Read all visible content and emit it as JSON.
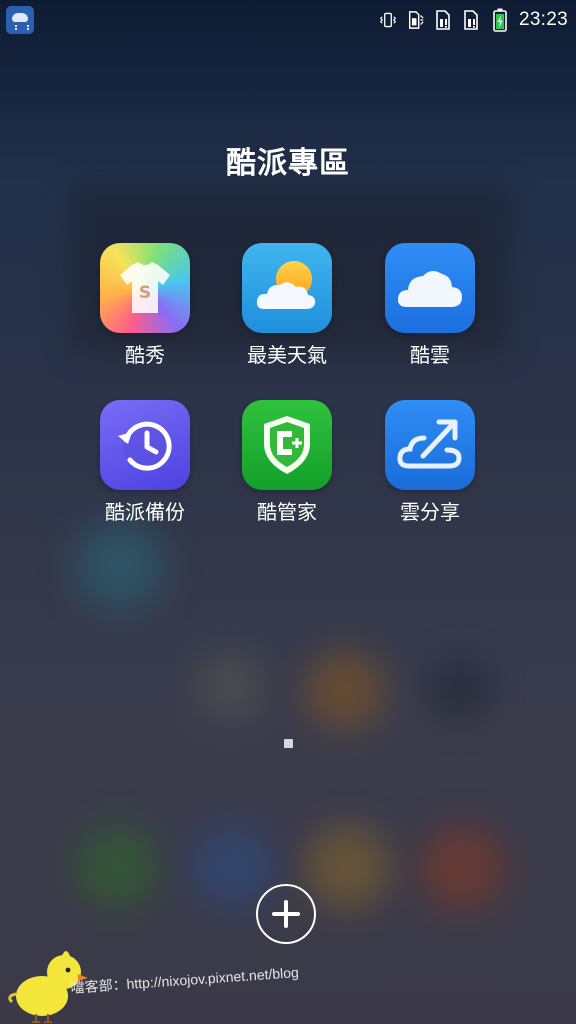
{
  "status_bar": {
    "time": "23:23",
    "icons": [
      "weather-notification-icon",
      "vibrate-icon",
      "sim1-volte-icon",
      "sim-card-icon",
      "sim-card-icon",
      "battery-charging-icon"
    ]
  },
  "folder": {
    "title": "酷派專區",
    "apps": [
      {
        "label": "酷秀",
        "icon": "tshirt-icon"
      },
      {
        "label": "最美天氣",
        "icon": "sun-cloud-icon"
      },
      {
        "label": "酷雲",
        "icon": "cloud-icon"
      },
      {
        "label": "酷派備份",
        "icon": "history-clock-icon"
      },
      {
        "label": "酷管家",
        "icon": "shield-plus-icon"
      },
      {
        "label": "雲分享",
        "icon": "cloud-share-arrow-icon"
      }
    ]
  },
  "add_button": {
    "icon": "plus-icon"
  },
  "watermark": {
    "text": "噹客部：http://nixojov.pixnet.net/blog"
  }
}
